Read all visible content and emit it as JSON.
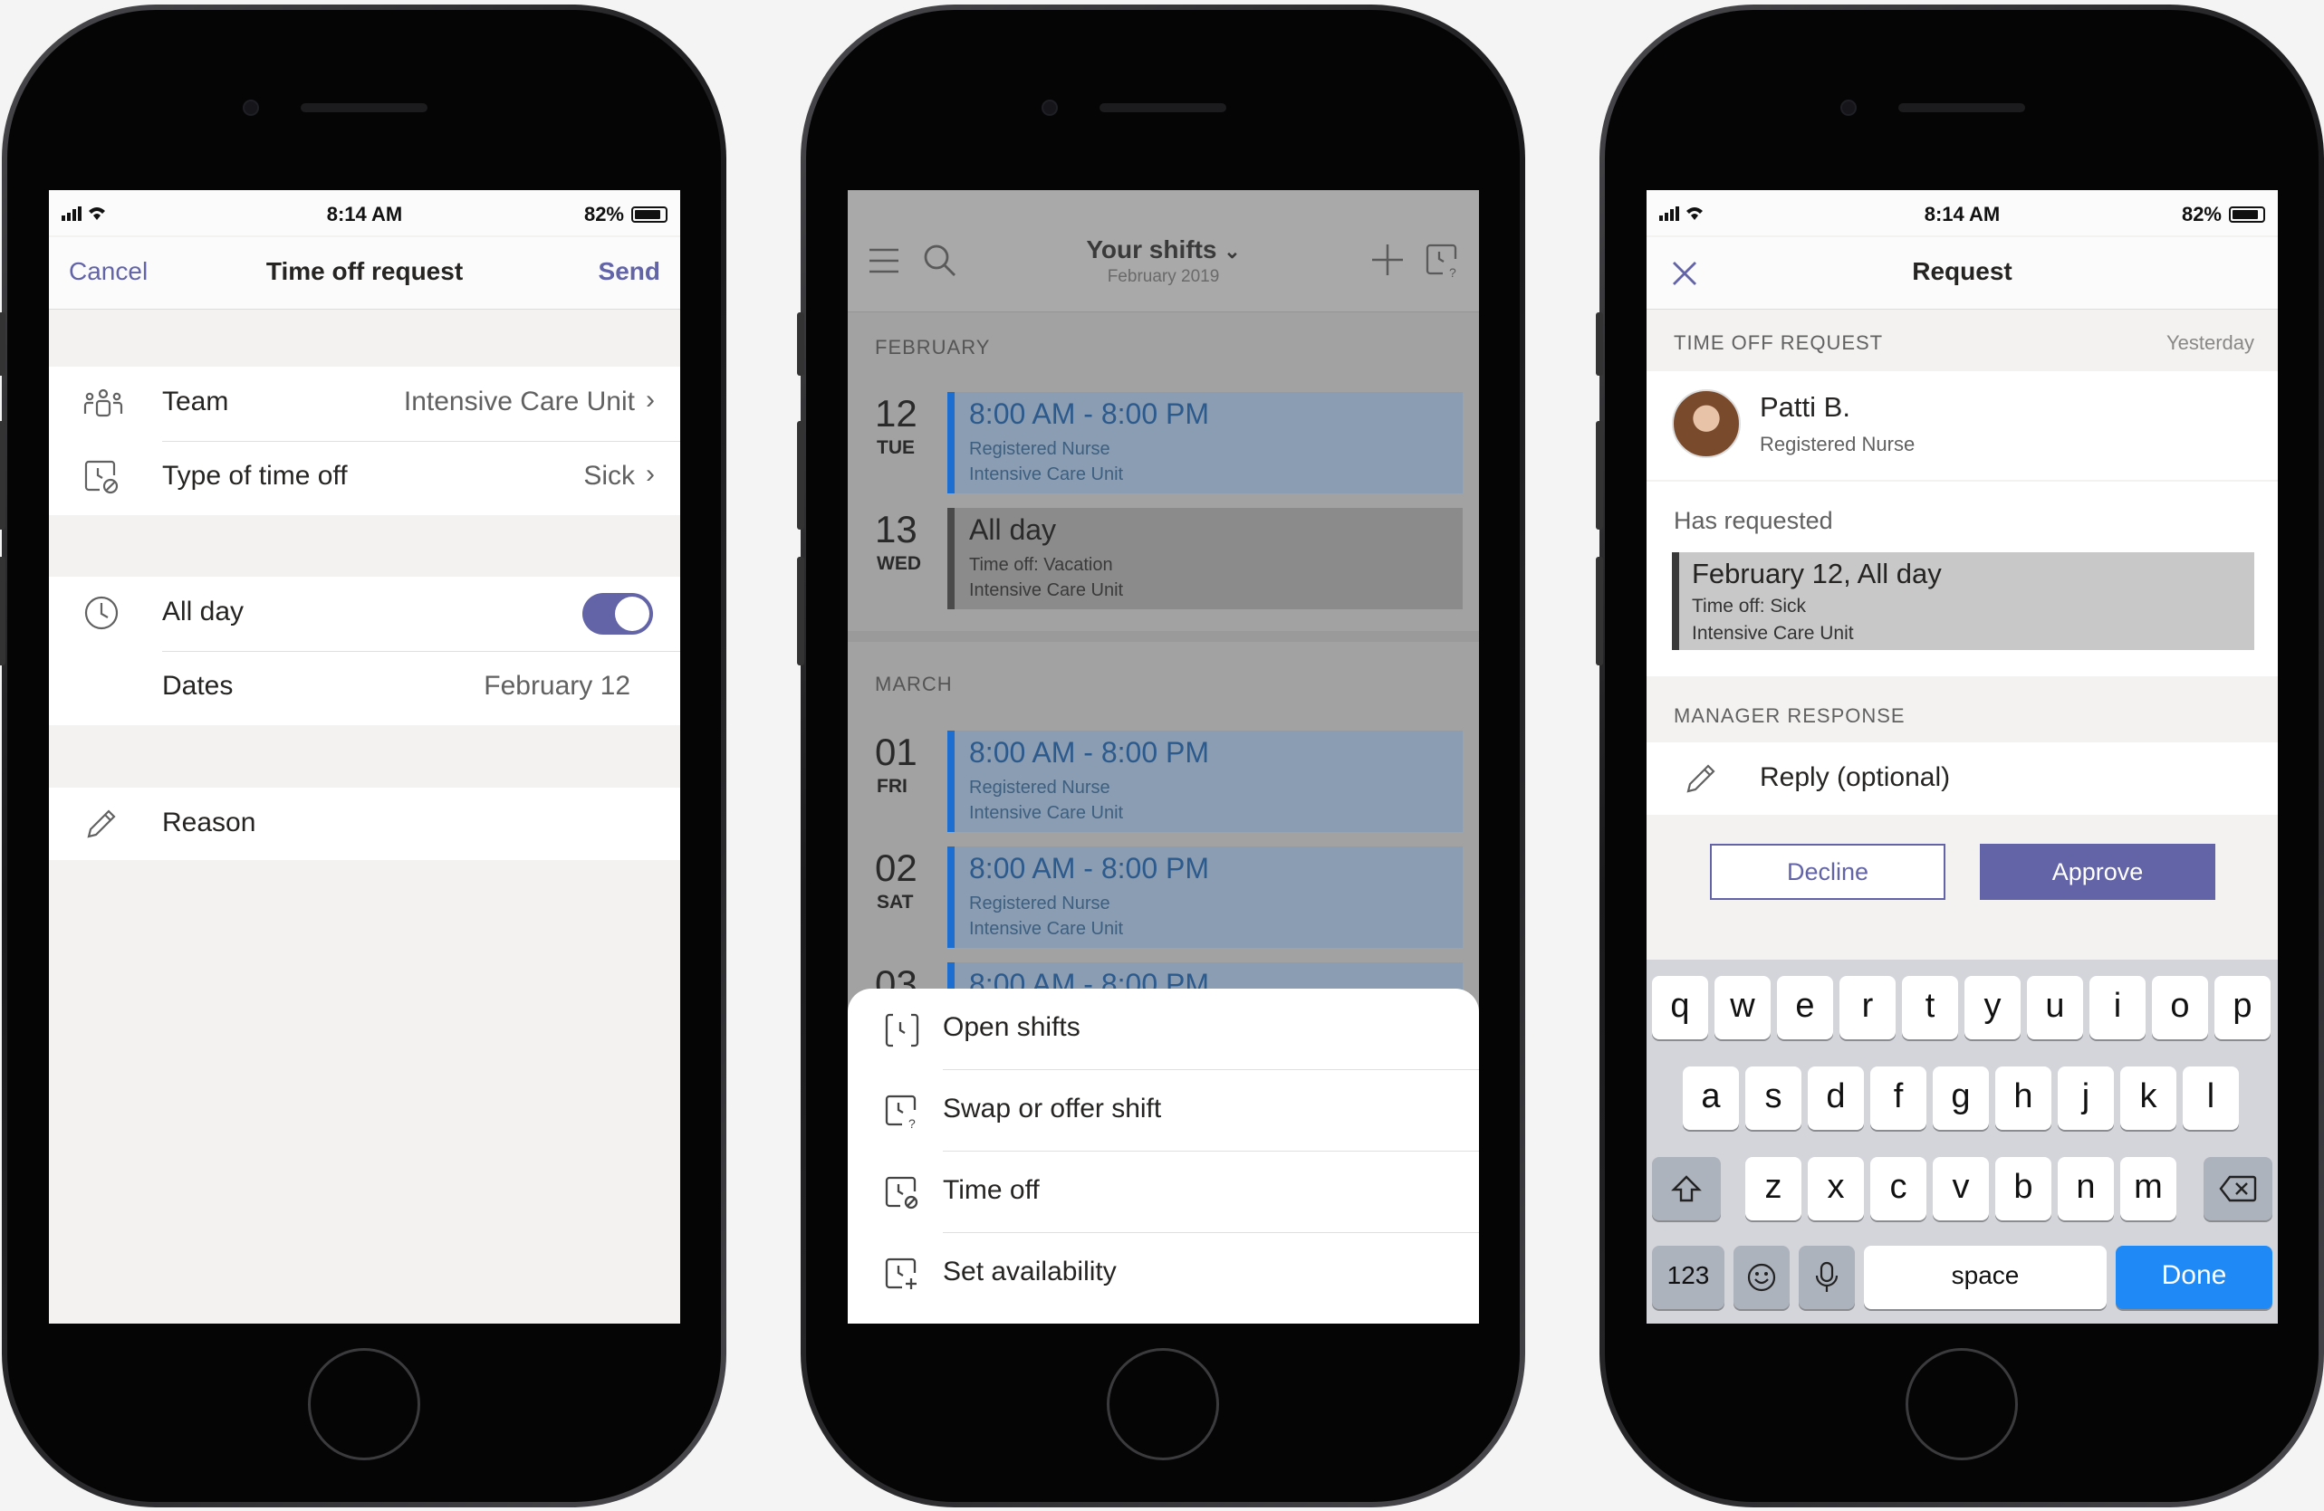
{
  "status": {
    "time": "8:14 AM",
    "battery": "82%"
  },
  "screen1": {
    "cancel": "Cancel",
    "title": "Time off request",
    "send": "Send",
    "team_label": "Team",
    "team_value": "Intensive Care Unit",
    "type_label": "Type of time off",
    "type_value": "Sick",
    "allday_label": "All day",
    "allday_on": true,
    "dates_label": "Dates",
    "dates_value": "February 12",
    "reason_label": "Reason"
  },
  "screen2": {
    "title": "Your shifts",
    "subtitle": "February 2019",
    "months": [
      "FEBRUARY",
      "MARCH"
    ],
    "shifts": [
      {
        "day": "12",
        "dow": "TUE",
        "time": "8:00 AM - 8:00 PM",
        "line2": "Registered Nurse",
        "line3": "Intensive Care Unit",
        "kind": "blue"
      },
      {
        "day": "13",
        "dow": "WED",
        "time": "All day",
        "line2": "Time off: Vacation",
        "line3": "Intensive Care Unit",
        "kind": "gray"
      },
      {
        "day": "01",
        "dow": "FRI",
        "time": "8:00 AM - 8:00 PM",
        "line2": "Registered Nurse",
        "line3": "Intensive Care Unit",
        "kind": "blue"
      },
      {
        "day": "02",
        "dow": "SAT",
        "time": "8:00 AM - 8:00 PM",
        "line2": "Registered Nurse",
        "line3": "Intensive Care Unit",
        "kind": "blue"
      },
      {
        "day": "03",
        "dow": "",
        "time": "8:00 AM - 8:00 PM",
        "line2": "",
        "line3": "",
        "kind": "blue"
      }
    ],
    "sheet": [
      "Open shifts",
      "Swap or offer shift",
      "Time off",
      "Set availability"
    ]
  },
  "screen3": {
    "title": "Request",
    "section1": "TIME OFF REQUEST",
    "section1_time": "Yesterday",
    "person_name": "Patti B.",
    "person_role": "Registered Nurse",
    "has_requested": "Has requested",
    "req_title": "February 12, All day",
    "req_line2": "Time off: Sick",
    "req_line3": "Intensive Care Unit",
    "section2": "MANAGER RESPONSE",
    "reply_placeholder": "Reply (optional)",
    "decline": "Decline",
    "approve": "Approve",
    "keyboard": {
      "row1": [
        "q",
        "w",
        "e",
        "r",
        "t",
        "y",
        "u",
        "i",
        "o",
        "p"
      ],
      "row2": [
        "a",
        "s",
        "d",
        "f",
        "g",
        "h",
        "j",
        "k",
        "l"
      ],
      "row3": [
        "z",
        "x",
        "c",
        "v",
        "b",
        "n",
        "m"
      ],
      "num": "123",
      "space": "space",
      "done": "Done"
    }
  },
  "colors": {
    "accent": "#6264a7",
    "shift_blue": "#1c6ed0",
    "done_blue": "#1f8af5"
  }
}
